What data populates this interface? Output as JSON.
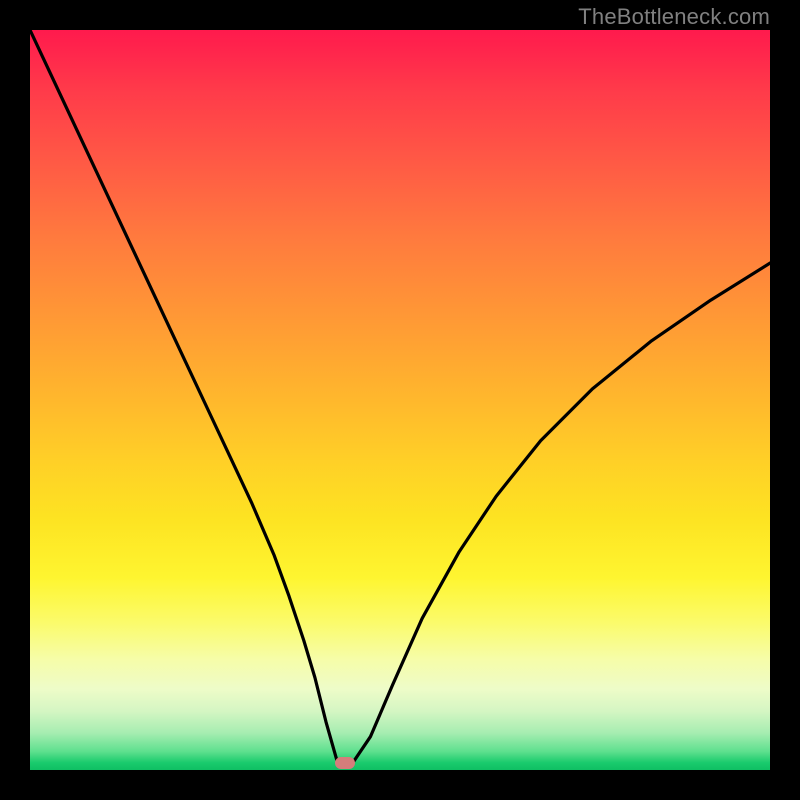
{
  "watermark": "TheBottleneck.com",
  "colors": {
    "frame": "#000000",
    "curve": "#000000",
    "marker": "#d47d7b",
    "watermark_text": "#808080"
  },
  "chart_data": {
    "type": "line",
    "title": "",
    "xlabel": "",
    "ylabel": "",
    "xlim": [
      0,
      100
    ],
    "ylim": [
      0,
      100
    ],
    "grid": false,
    "legend": false,
    "series": [
      {
        "name": "bottleneck-curve",
        "x": [
          0,
          3,
          6,
          9,
          12,
          15,
          18,
          21,
          24,
          27,
          30,
          33,
          35,
          37,
          38.5,
          40,
          41.5,
          43.5,
          46,
          49,
          53,
          58,
          63,
          69,
          76,
          84,
          92,
          100
        ],
        "y": [
          100,
          93.6,
          87.2,
          80.8,
          74.4,
          68,
          61.6,
          55.2,
          48.8,
          42.4,
          36,
          29,
          23.5,
          17.5,
          12.5,
          6.5,
          1.2,
          0.8,
          4.5,
          11.5,
          20.5,
          29.5,
          37,
          44.5,
          51.5,
          58,
          63.5,
          68.5
        ]
      }
    ],
    "annotations": [
      {
        "name": "min-marker",
        "x": 42.5,
        "y": 0.5,
        "shape": "rounded-rect",
        "color": "#d47d7b"
      }
    ],
    "background_gradient_stops": [
      {
        "pos": 0,
        "color": "#ff1a4d"
      },
      {
        "pos": 0.5,
        "color": "#ffb22e"
      },
      {
        "pos": 0.78,
        "color": "#fef530"
      },
      {
        "pos": 0.99,
        "color": "#1acb6d"
      },
      {
        "pos": 1.0,
        "color": "#0fbf63"
      }
    ]
  },
  "marker": {
    "left_pct": 42.5,
    "top_pct": 99.1
  }
}
